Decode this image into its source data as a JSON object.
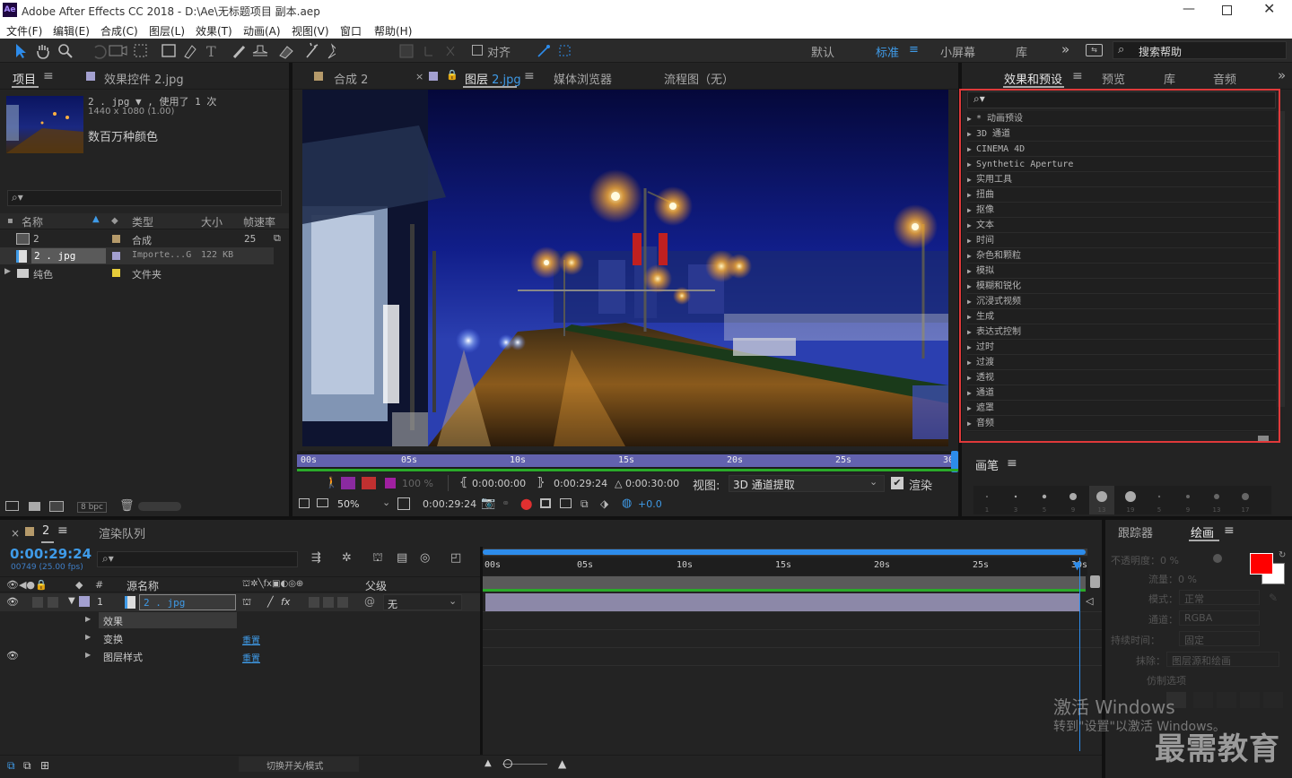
{
  "window": {
    "title": "Adobe After Effects CC 2018 - D:\\Ae\\无标题项目 副本.aep",
    "logo": "Ae"
  },
  "menu": [
    "文件(F)",
    "编辑(E)",
    "合成(C)",
    "图层(L)",
    "效果(T)",
    "动画(A)",
    "视图(V)",
    "窗口",
    "帮助(H)"
  ],
  "toolbar": {
    "snap_label": "对齐",
    "workspaces": [
      "默认",
      "标准",
      "小屏幕",
      "库"
    ],
    "active_workspace": "标准",
    "search_help": "搜索帮助"
  },
  "project_panel": {
    "tab_project": "项目",
    "tab_effect_controls": "效果控件 2.jpg",
    "asset_name": "2 . jpg ▼ , 使用了 1 次",
    "asset_dims": "1440 x 1080 (1.00)",
    "asset_colors": "数百万种颜色",
    "columns": [
      "名称",
      "类型",
      "大小",
      "帧速率"
    ],
    "rows": [
      {
        "name": "2",
        "type": "合成",
        "size": "",
        "fps": "25",
        "color": "#b59a6a"
      },
      {
        "name": "2 . jpg",
        "type": "Importe...G",
        "size": "122 KB",
        "fps": "",
        "color": "#a3a0d0"
      },
      {
        "name": "纯色",
        "type": "文件夹",
        "size": "",
        "fps": "",
        "color": "#e6cc3a"
      }
    ],
    "bpc": "8 bpc"
  },
  "viewer": {
    "tabs": [
      "合成 2",
      "图层 2.jpg",
      "媒体浏览器",
      "流程图（无）"
    ],
    "layer_tab_prefix": "图层",
    "layer_tab_file": "2.jpg",
    "ruler": [
      "00s",
      "05s",
      "10s",
      "15s",
      "20s",
      "25s",
      "30s"
    ],
    "start_time": "0:00:00:00",
    "end_time": "0:00:29:24",
    "duration": "△ 0:00:30:00",
    "view_label": "视图:",
    "view_value": "3D 通道提取",
    "render_label": "渲染",
    "opacity": "100 %",
    "zoom": "50%",
    "current_time": "0:00:29:24",
    "exposure": "+0.0"
  },
  "effects_panel": {
    "tabs": [
      "效果和预设",
      "预览",
      "库",
      "音频"
    ],
    "items": [
      "* 动画预设",
      "3D 通道",
      "CINEMA 4D",
      "Synthetic Aperture",
      "实用工具",
      "扭曲",
      "抠像",
      "文本",
      "时间",
      "杂色和颗粒",
      "模拟",
      "模糊和锐化",
      "沉浸式视频",
      "生成",
      "表达式控制",
      "过时",
      "过渡",
      "透视",
      "通道",
      "遮罩",
      "音频"
    ],
    "highlight_color": "#e0393a"
  },
  "brush_panel": {
    "title": "画笔",
    "sizes": [
      "1",
      "3",
      "5",
      "9",
      "13",
      "19",
      "5",
      "9",
      "13",
      "17"
    ]
  },
  "timeline": {
    "tabs": [
      "2",
      "渲染队列"
    ],
    "timecode": "0:00:29:24",
    "frame_info": "00749 (25.00 fps)",
    "col_source": "源名称",
    "col_parent": "父级",
    "layer_num": "1",
    "layer_name": "2 . jpg",
    "parent_value": "无",
    "sub_rows": [
      {
        "label": "效果",
        "value": ""
      },
      {
        "label": "变换",
        "value": "重置"
      },
      {
        "label": "图层样式",
        "value": "重置"
      }
    ],
    "ruler": [
      "00s",
      "05s",
      "10s",
      "15s",
      "20s",
      "25s",
      "30s"
    ],
    "switch_mode": "切换开关/模式"
  },
  "paint_panel": {
    "tab_tracker": "跟踪器",
    "tab_paint": "绘画",
    "opacity": "不透明度：0 %",
    "flow": "流量：0 %",
    "mode_label": "模式：",
    "mode_value": "正常",
    "channel_label": "通道：",
    "channel_value": "RGBA",
    "duration_label": "持续时间：",
    "duration_value": "固定",
    "erase_label": "抹除：",
    "erase_value": "图层源和绘画",
    "clone_label": "仿制选项",
    "fg_color": "#ff0000",
    "bg_color": "#ffffff"
  },
  "watermark": {
    "line1": "激活 Windows",
    "line2": "转到\"设置\"以激活 Windows。",
    "brand": "最需教育"
  }
}
